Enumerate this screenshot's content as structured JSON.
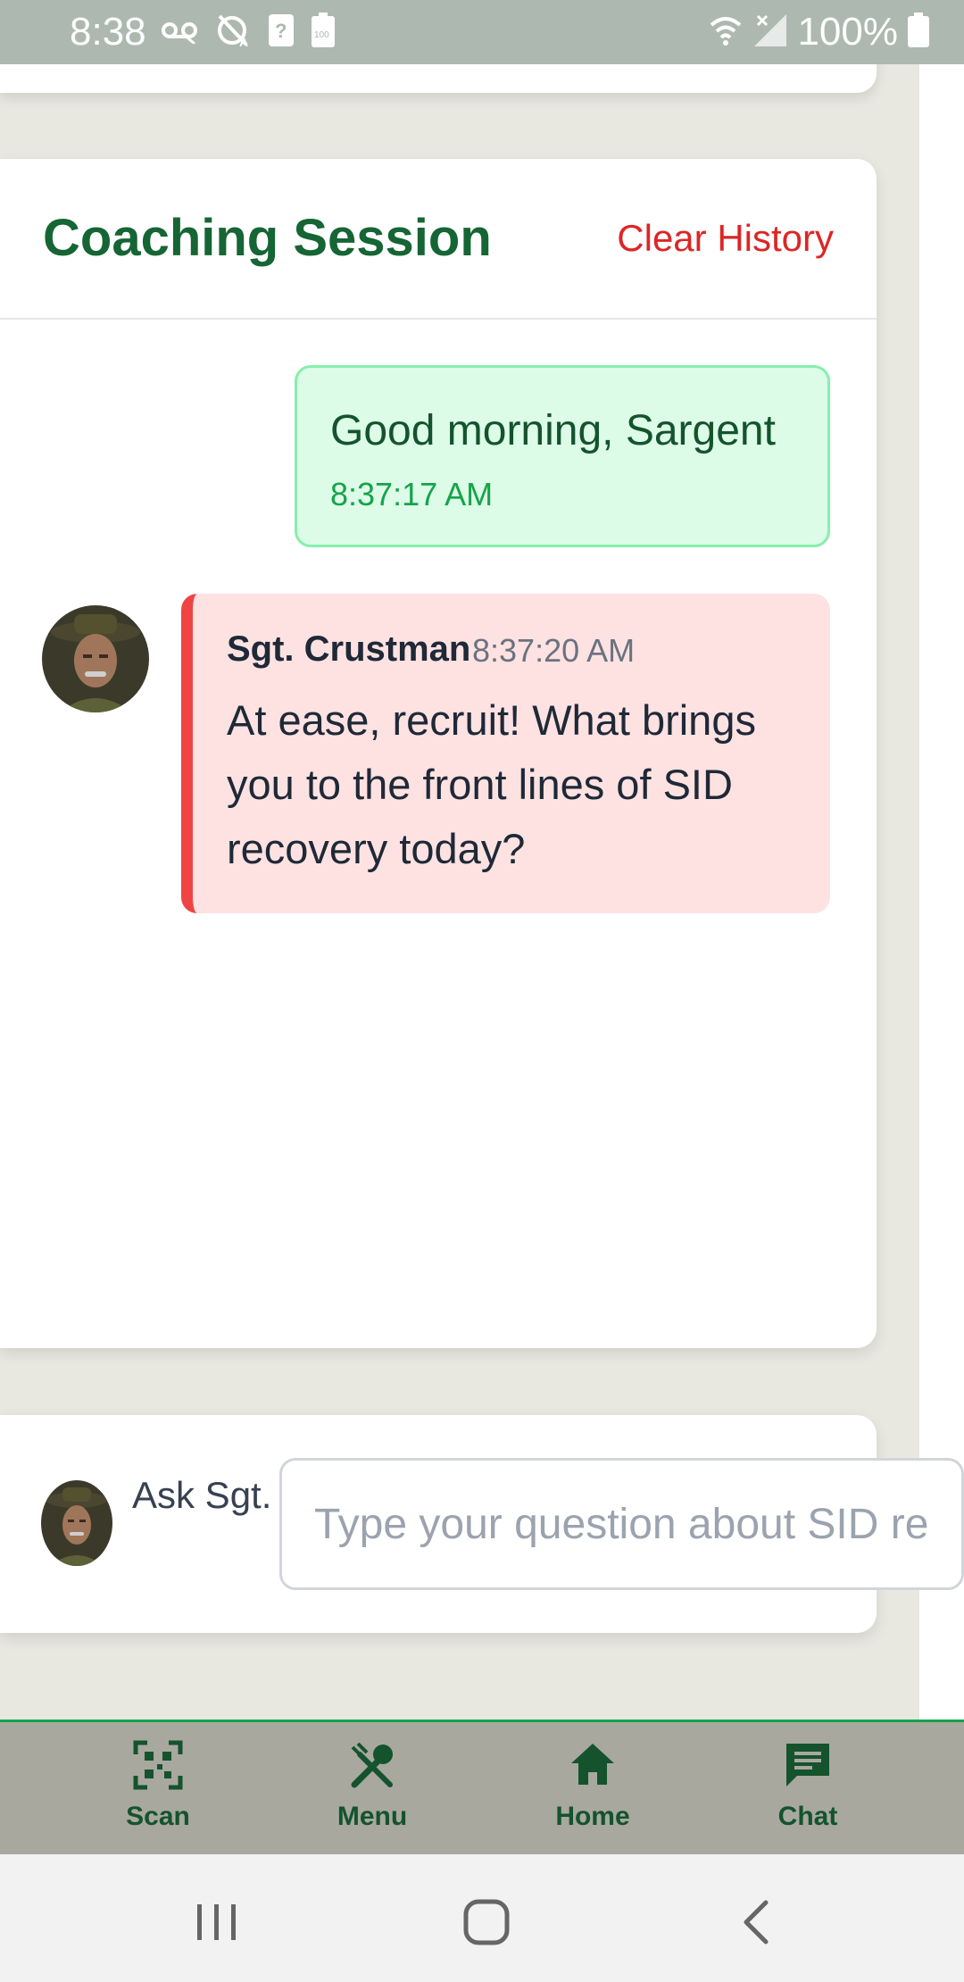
{
  "status_bar": {
    "time": "8:38",
    "battery_text": "100%",
    "battery_small_label": "100"
  },
  "coaching": {
    "title": "Coaching Session",
    "clear_history_label": "Clear History"
  },
  "messages": [
    {
      "sender": "user",
      "text": "Good morning, Sargent",
      "time": "8:37:17 AM"
    },
    {
      "sender": "Sgt. Crustman",
      "text": "At ease, recruit! What brings you to the front lines of SID recovery today?",
      "time": "8:37:20 AM"
    }
  ],
  "ask": {
    "label": "Ask Sgt. Crustman",
    "placeholder": "Type your question about SID recovery..."
  },
  "bottom_nav": {
    "items": [
      {
        "label": "Scan",
        "icon": "qr-scan-icon"
      },
      {
        "label": "Menu",
        "icon": "utensils-icon"
      },
      {
        "label": "Home",
        "icon": "home-icon"
      },
      {
        "label": "Chat",
        "icon": "chat-icon"
      }
    ]
  },
  "colors": {
    "brand_green": "#166534",
    "danger_red": "#dc2626",
    "user_bubble_bg": "#dcfce7",
    "bot_bubble_bg": "#fee2e2",
    "bot_bubble_accent": "#ef4444",
    "nav_bg": "#a8a89f",
    "status_bar_bg": "#adb8b1"
  }
}
